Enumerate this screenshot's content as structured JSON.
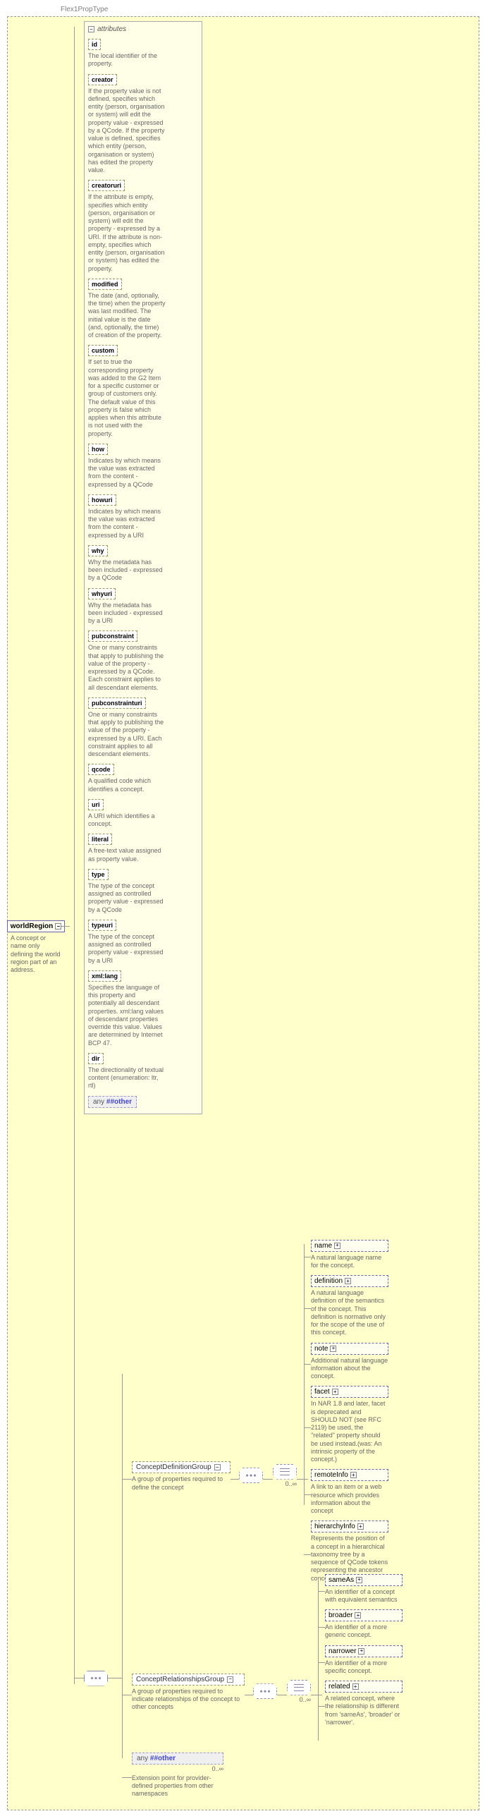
{
  "root_type": "Flex1PropType",
  "world_region": {
    "name": "worldRegion",
    "desc": "A concept or name only defining the world region part of an address."
  },
  "attributes_header": "attributes",
  "attributes": [
    {
      "name": "id",
      "desc": "The local identifier of the property."
    },
    {
      "name": "creator",
      "desc": "If the property value is not defined, specifies which entity (person, organisation or system) will edit the property value - expressed by a QCode. If the property value is defined, specifies which entity (person, organisation or system) has edited the property value."
    },
    {
      "name": "creatoruri",
      "desc": "If the attribute is empty, specifies which entity (person, organisation or system) will edit the property - expressed by a URI. If the attribute is non-empty, specifies which entity (person, organisation or system) has edited the property."
    },
    {
      "name": "modified",
      "desc": "The date (and, optionally, the time) when the property was last modified. The initial value is the date (and, optionally, the time) of creation of the property."
    },
    {
      "name": "custom",
      "desc": "If set to true the corresponding property was added to the G2 Item for a specific customer or group of customers only. The default value of this property is false which applies when this attribute is not used with the property."
    },
    {
      "name": "how",
      "desc": "Indicates by which means the value was extracted from the content - expressed by a QCode"
    },
    {
      "name": "howuri",
      "desc": "Indicates by which means the value was extracted from the content - expressed by a URI"
    },
    {
      "name": "why",
      "desc": "Why the metadata has been included - expressed by a QCode"
    },
    {
      "name": "whyuri",
      "desc": "Why the metadata has been included - expressed by a URI"
    },
    {
      "name": "pubconstraint",
      "desc": "One or many constraints that apply to publishing the value of the property - expressed by a QCode. Each constraint applies to all descendant elements."
    },
    {
      "name": "pubconstrainturi",
      "desc": "One or many constraints that apply to publishing the value of the property - expressed by a URI. Each constraint applies to all descendant elements."
    },
    {
      "name": "qcode",
      "desc": "A qualified code which identifies a concept."
    },
    {
      "name": "uri",
      "desc": "A URI which identifies a concept."
    },
    {
      "name": "literal",
      "desc": "A free-text value assigned as property value."
    },
    {
      "name": "type",
      "desc": "The type of the concept assigned as controlled property value - expressed by a QCode"
    },
    {
      "name": "typeuri",
      "desc": "The type of the concept assigned as controlled property value - expressed by a URI"
    },
    {
      "name": "xml:lang",
      "desc": "Specifies the language of this property and potentially all descendant properties. xml:lang values of descendant properties override this value. Values are determined by Internet BCP 47."
    },
    {
      "name": "dir",
      "desc": "The directionality of textual content (enumeration: ltr, rtl)"
    }
  ],
  "any_attr": {
    "name": "any",
    "ns": "##other"
  },
  "groups": {
    "cdg": {
      "name": "ConceptDefinitionGroup",
      "desc": "A group of properties required to define the concept",
      "card": "0..∞"
    },
    "crg": {
      "name": "ConceptRelationshipsGroup",
      "desc": "A group of properties required to indicate relationships of the concept to other concepts",
      "card": "0..∞"
    }
  },
  "any_elem": {
    "name": "any",
    "ns": "##other",
    "card": "0..∞",
    "desc": "Extension point for provider-defined properties from other namespaces"
  },
  "cdg_children": [
    {
      "name": "name",
      "desc": "A natural language name for the concept."
    },
    {
      "name": "definition",
      "desc": "A natural language definition of the semantics of the concept. This definition is normative only for the scope of the use of this concept."
    },
    {
      "name": "note",
      "desc": "Additional natural language information about the concept."
    },
    {
      "name": "facet",
      "desc": "In NAR 1.8 and later, facet is deprecated and SHOULD NOT (see RFC 2119) be used, the \"related\" property should be used instead.(was: An intrinsic property of the concept.)"
    },
    {
      "name": "remoteInfo",
      "desc": "A link to an item or a web resource which provides information about the concept"
    },
    {
      "name": "hierarchyInfo",
      "desc": "Represents the position of a concept in a hierarchical taxonomy tree by a sequence of QCode tokens representing the ancestor concepts and this concept"
    }
  ],
  "crg_children": [
    {
      "name": "sameAs",
      "desc": "An identifier of a concept with equivalent semantics"
    },
    {
      "name": "broader",
      "desc": "An identifier of a more generic concept."
    },
    {
      "name": "narrower",
      "desc": "An identifier of a more specific concept."
    },
    {
      "name": "related",
      "desc": "A related concept, where the relationship is different from 'sameAs', 'broader' or 'narrower'."
    }
  ]
}
